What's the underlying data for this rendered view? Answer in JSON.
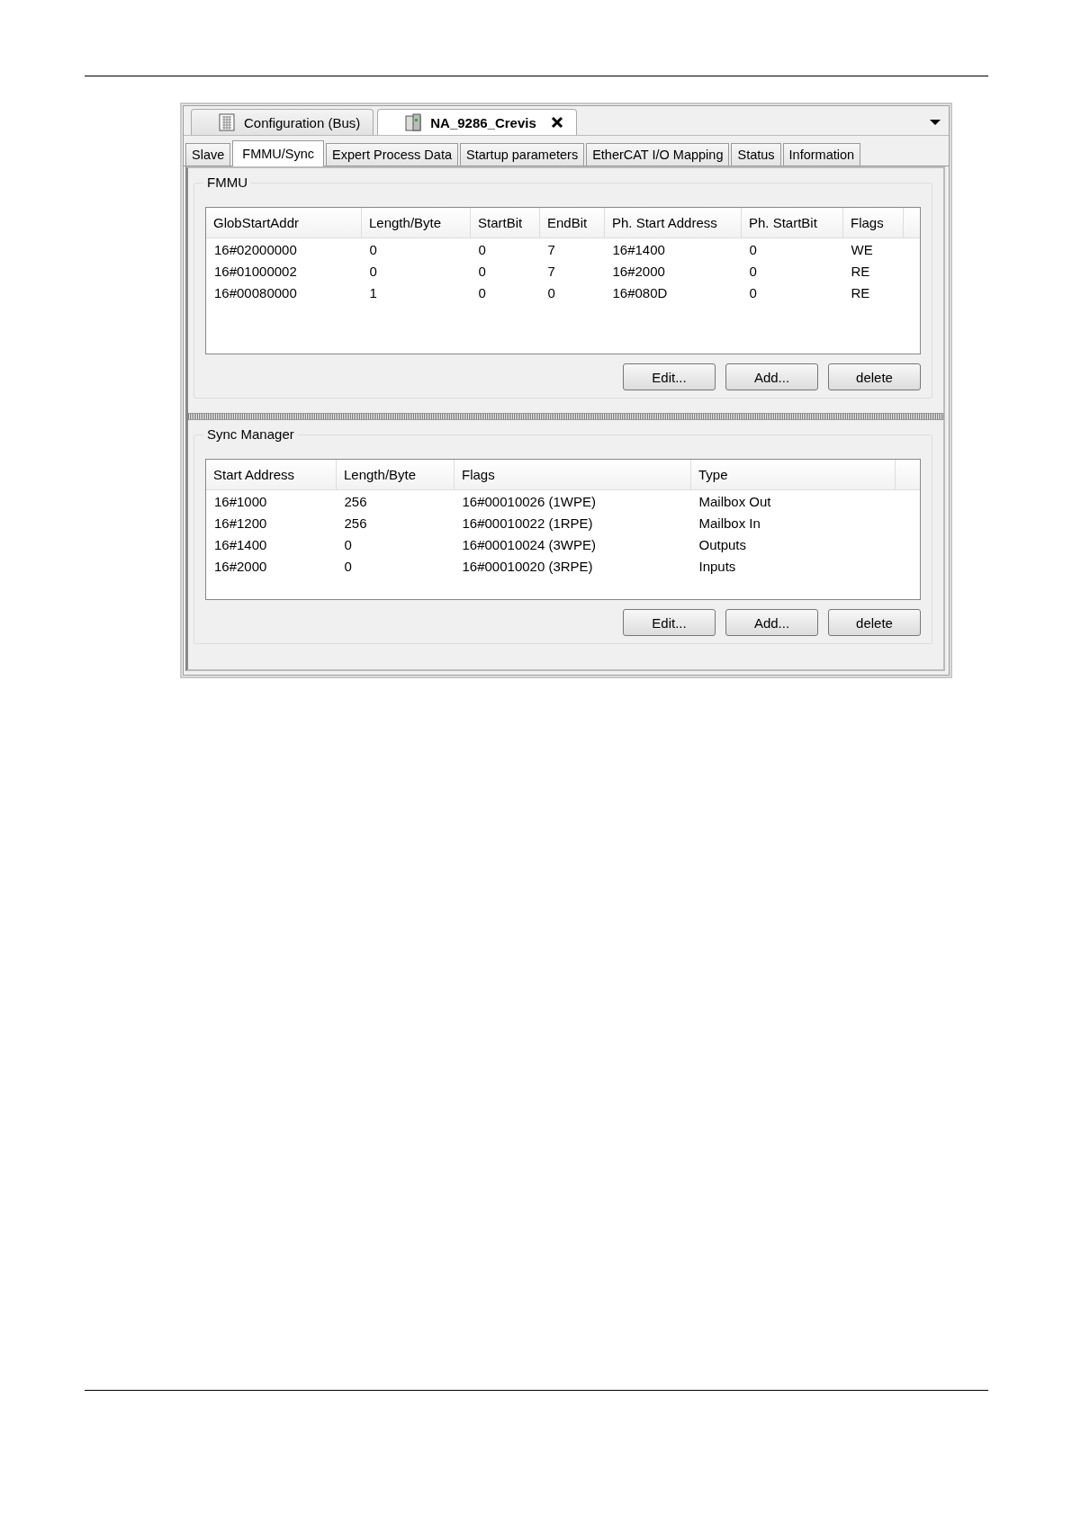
{
  "document_tabs": [
    {
      "label": "Configuration (Bus)",
      "selected": false,
      "kind": "grid"
    },
    {
      "label": "NA_9286_Crevis",
      "selected": true,
      "kind": "device"
    }
  ],
  "tabs": [
    {
      "label": "Slave",
      "selected": false
    },
    {
      "label": "FMMU/Sync",
      "selected": true
    },
    {
      "label": "Expert Process Data",
      "selected": false
    },
    {
      "label": "Startup parameters",
      "selected": false
    },
    {
      "label": "EtherCAT I/O Mapping",
      "selected": false
    },
    {
      "label": "Status",
      "selected": false
    },
    {
      "label": "Information",
      "selected": false
    }
  ],
  "fmmu": {
    "title": "FMMU",
    "columns": [
      "GlobStartAddr",
      "Length/Byte",
      "StartBit",
      "EndBit",
      "Ph. Start Address",
      "Ph. StartBit",
      "Flags"
    ],
    "rows": [
      [
        "16#02000000",
        "0",
        "0",
        "7",
        "16#1400",
        "0",
        "WE"
      ],
      [
        "16#01000002",
        "0",
        "0",
        "7",
        "16#2000",
        "0",
        "RE"
      ],
      [
        "16#00080000",
        "1",
        "0",
        "0",
        "16#080D",
        "0",
        "RE"
      ]
    ],
    "buttons": [
      "Edit...",
      "Add...",
      "delete"
    ]
  },
  "sync_manager": {
    "title": "Sync Manager",
    "columns": [
      "Start Address",
      "Length/Byte",
      "Flags",
      "Type"
    ],
    "rows": [
      [
        "16#1000",
        "256",
        "16#00010026 (1WPE)",
        "Mailbox Out"
      ],
      [
        "16#1200",
        "256",
        "16#00010022 (1RPE)",
        "Mailbox In"
      ],
      [
        "16#1400",
        "0",
        "16#00010024 (3WPE)",
        "Outputs"
      ],
      [
        "16#2000",
        "0",
        "16#00010020 (3RPE)",
        "Inputs"
      ]
    ],
    "buttons": [
      "Edit...",
      "Add...",
      "delete"
    ]
  }
}
